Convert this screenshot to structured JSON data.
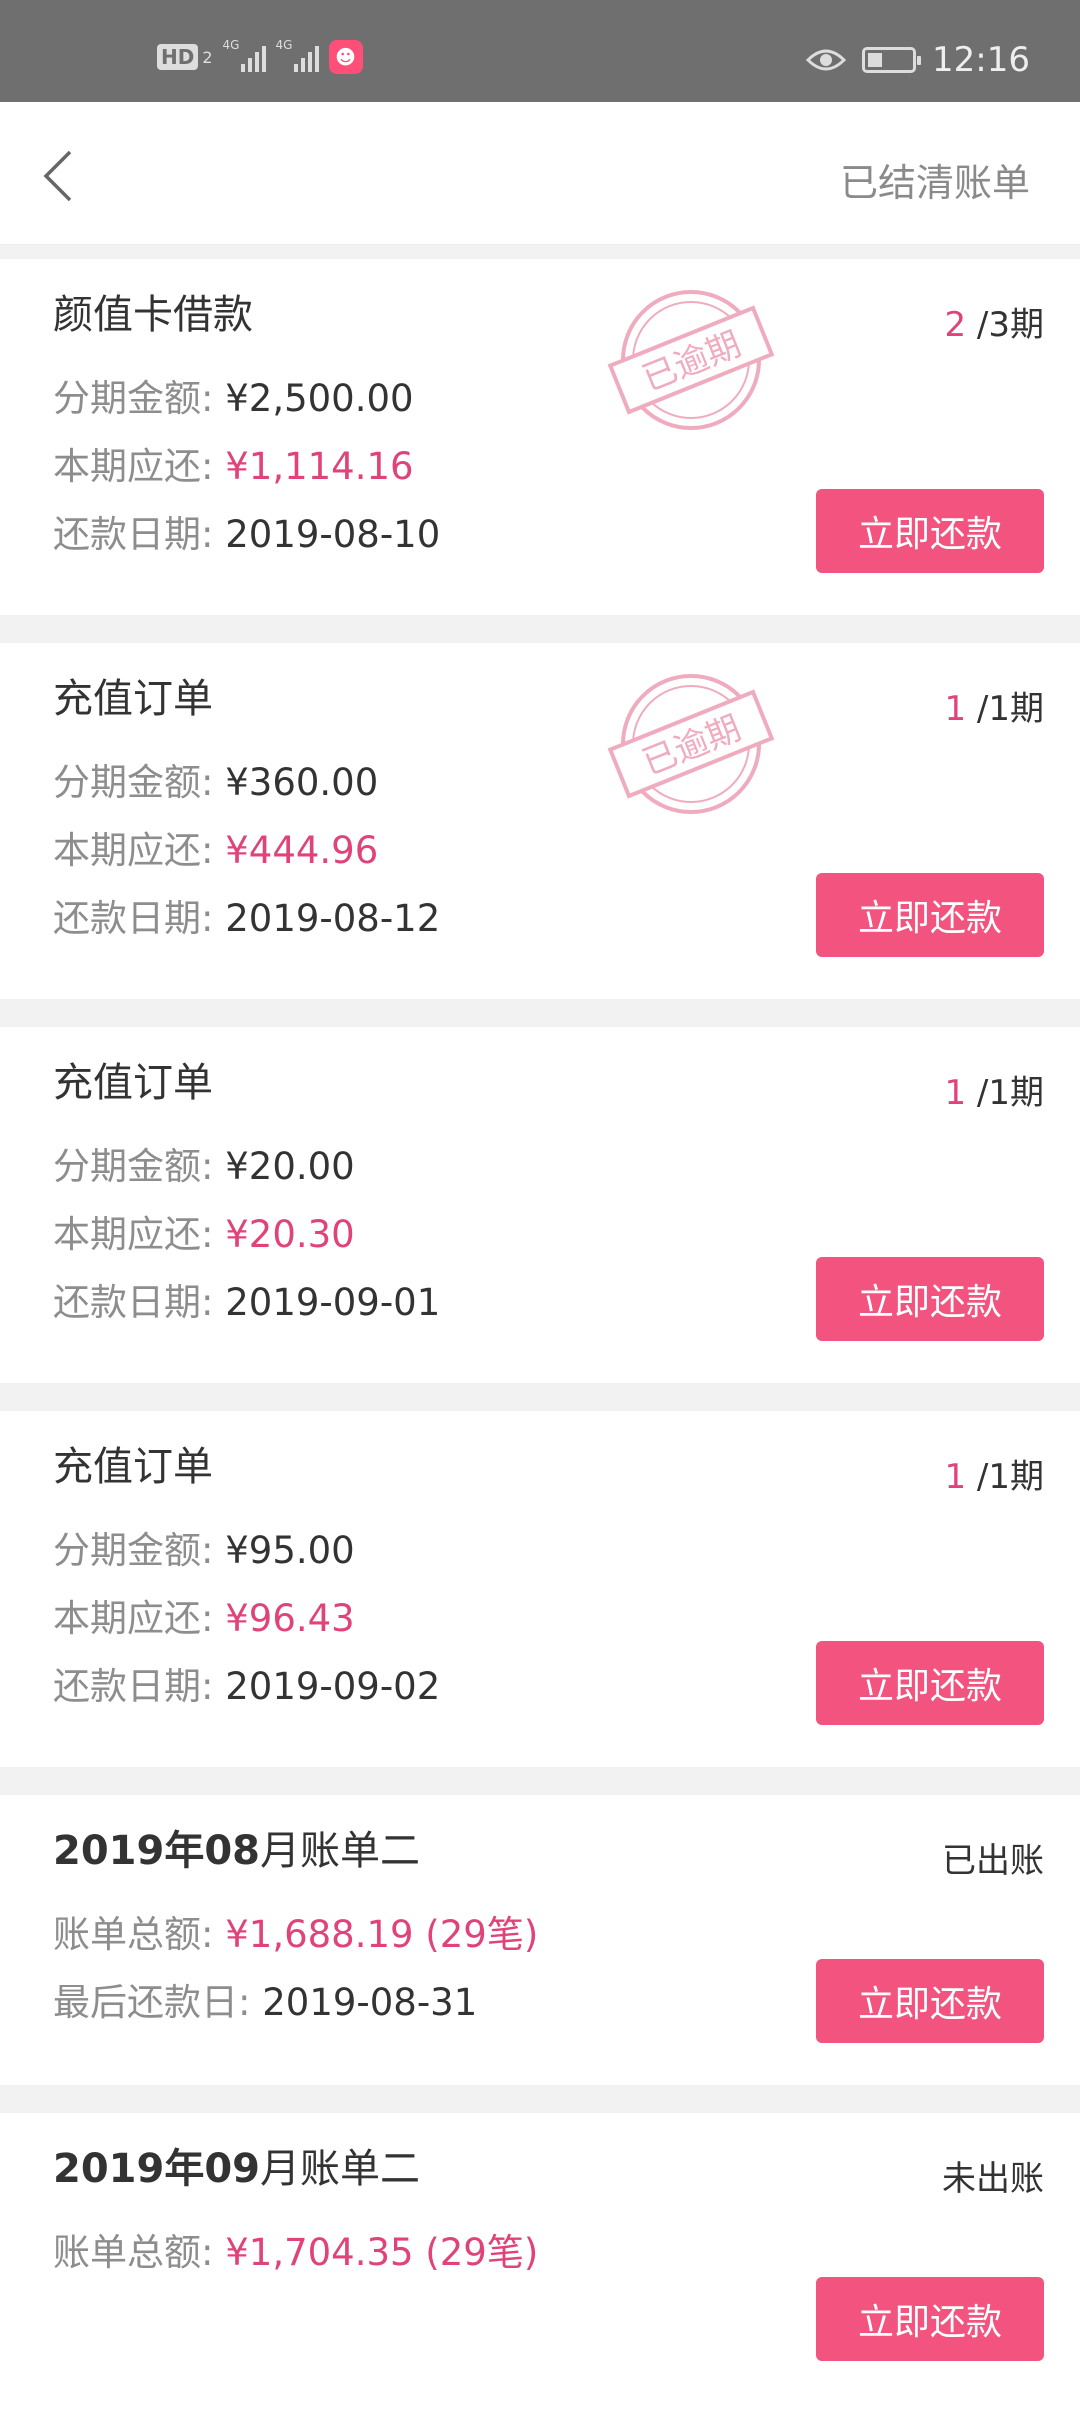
{
  "status_bar": {
    "hd": "HD",
    "sim": "2",
    "network_1": "4G",
    "network_2": "4G",
    "time": "12:16"
  },
  "header": {
    "right_link": "已结清账单"
  },
  "loans": [
    {
      "title": "颜值卡借款",
      "period_current": "2",
      "period_total": "/3期",
      "stamp": "已逾期",
      "rows": [
        {
          "label": "分期金额: ",
          "value": "¥2,500.00",
          "highlight": false
        },
        {
          "label": "本期应还: ",
          "value": "¥1,114.16",
          "highlight": true
        },
        {
          "label": "还款日期: ",
          "value": "2019-08-10",
          "highlight": false
        }
      ],
      "button": "立即还款"
    },
    {
      "title": "充值订单",
      "period_current": "1",
      "period_total": "/1期",
      "stamp": "已逾期",
      "rows": [
        {
          "label": "分期金额: ",
          "value": "¥360.00",
          "highlight": false
        },
        {
          "label": "本期应还: ",
          "value": "¥444.96",
          "highlight": true
        },
        {
          "label": "还款日期: ",
          "value": "2019-08-12",
          "highlight": false
        }
      ],
      "button": "立即还款"
    },
    {
      "title": "充值订单",
      "period_current": "1",
      "period_total": "/1期",
      "rows": [
        {
          "label": "分期金额: ",
          "value": "¥20.00",
          "highlight": false
        },
        {
          "label": "本期应还: ",
          "value": "¥20.30",
          "highlight": true
        },
        {
          "label": "还款日期: ",
          "value": "2019-09-01",
          "highlight": false
        }
      ],
      "button": "立即还款"
    },
    {
      "title": "充值订单",
      "period_current": "1",
      "period_total": "/1期",
      "rows": [
        {
          "label": "分期金额: ",
          "value": "¥95.00",
          "highlight": false
        },
        {
          "label": "本期应还: ",
          "value": "¥96.43",
          "highlight": true
        },
        {
          "label": "还款日期: ",
          "value": "2019-09-02",
          "highlight": false
        }
      ],
      "button": "立即还款"
    }
  ],
  "bills": [
    {
      "title_bold": "2019年08",
      "title_rest": "月账单二",
      "status": "已出账",
      "total_label": "账单总额: ",
      "total_value": "¥1,688.19 (29笔)",
      "due_label": "最后还款日: ",
      "due_value": "2019-08-31",
      "button": "立即还款"
    },
    {
      "title_bold": "2019年09",
      "title_rest": "月账单二",
      "status": "未出账",
      "total_label": "账单总额: ",
      "total_value": "¥1,704.35 (29笔)",
      "button": "立即还款"
    }
  ],
  "colors": {
    "accent": "#f2537f",
    "highlight_text": "#e0437a",
    "status_bar": "#6f6f6f"
  }
}
